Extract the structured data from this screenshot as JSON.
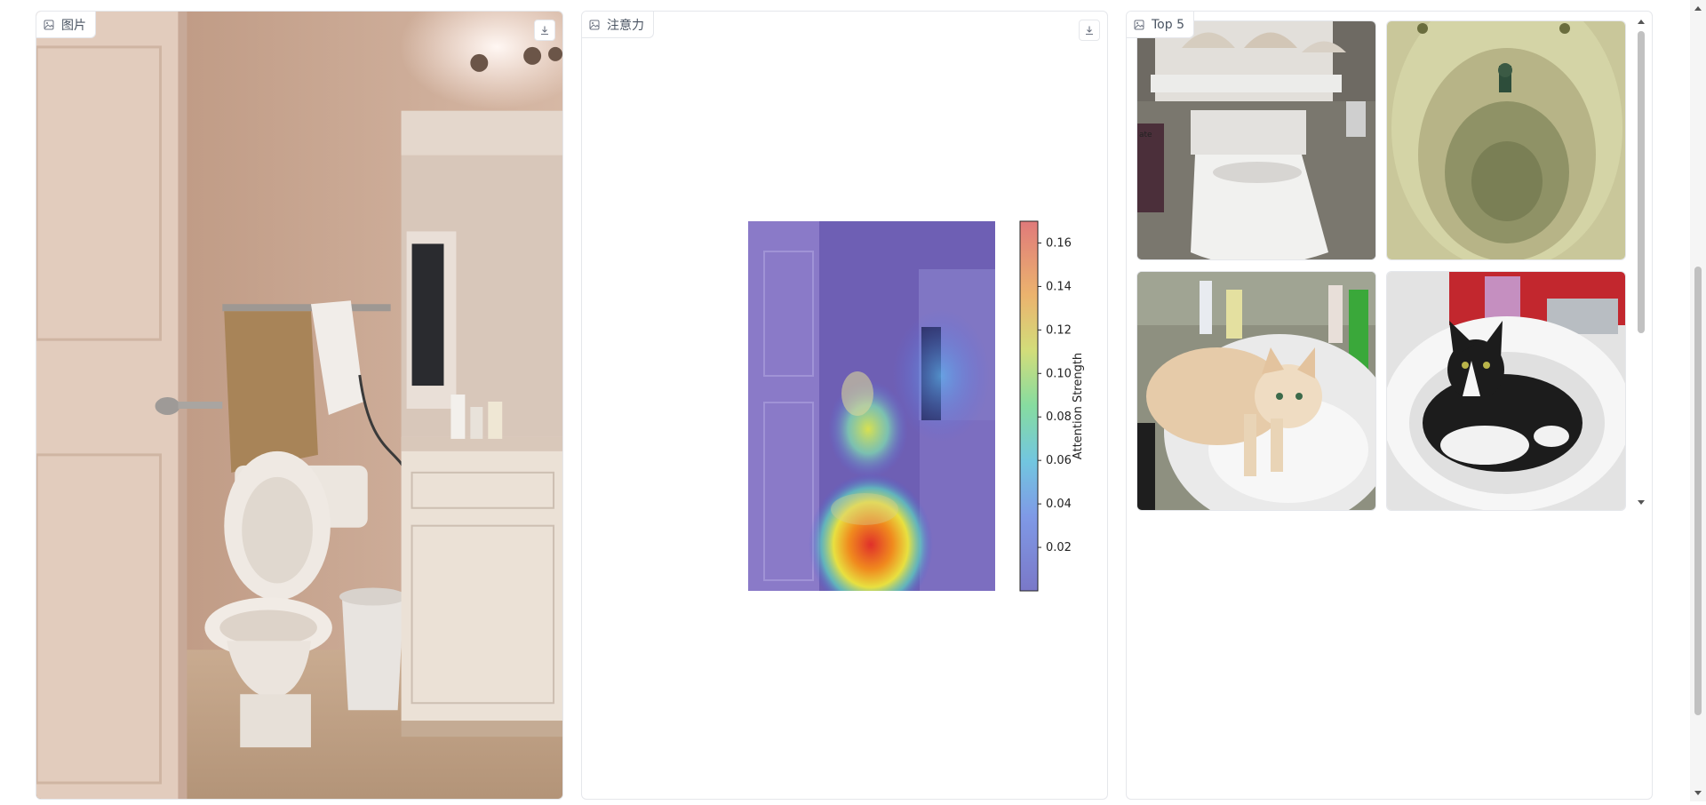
{
  "panels": {
    "image": {
      "label": "图片",
      "icon": "image-icon",
      "download_icon": "download-icon"
    },
    "attention": {
      "label": "注意力",
      "icon": "image-icon",
      "download_icon": "download-icon"
    },
    "top5": {
      "label": "Top 5",
      "icon": "image-icon"
    }
  },
  "chart_data": {
    "type": "heatmap",
    "colorbar": {
      "label": "Attention Strength",
      "ticks": [
        "0.02",
        "0.04",
        "0.06",
        "0.08",
        "0.10",
        "0.12",
        "0.14",
        "0.16"
      ],
      "min": 0.0,
      "max": 0.17,
      "colormap": "jet"
    }
  },
  "gallery": [
    {
      "alt": "toilet with seashells"
    },
    {
      "alt": "green toilet bowl"
    },
    {
      "alt": "cream cat in sink"
    },
    {
      "alt": "black and white cat in sink"
    }
  ],
  "gallery_partial_text": "ate",
  "colors": {
    "border": "#e5e7eb",
    "text": "#4b5563",
    "scrollbar": "#c1c1c1"
  }
}
